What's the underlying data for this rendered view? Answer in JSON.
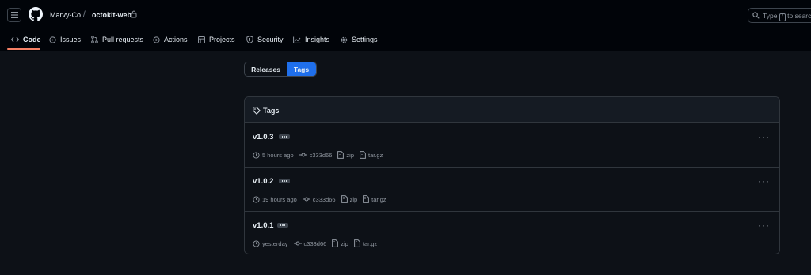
{
  "header": {
    "owner": "Marvy-Co",
    "separator": "/",
    "repo": "octokit-web",
    "search": {
      "placeholder_prefix": "Type",
      "shortcut": "/",
      "placeholder_suffix": "to search"
    }
  },
  "nav": {
    "tabs": [
      {
        "label": "Code",
        "icon": "code-icon",
        "active": true
      },
      {
        "label": "Issues",
        "icon": "issue-icon"
      },
      {
        "label": "Pull requests",
        "icon": "pull-request-icon"
      },
      {
        "label": "Actions",
        "icon": "play-icon"
      },
      {
        "label": "Projects",
        "icon": "table-icon"
      },
      {
        "label": "Security",
        "icon": "shield-icon"
      },
      {
        "label": "Insights",
        "icon": "graph-icon"
      },
      {
        "label": "Settings",
        "icon": "gear-icon"
      }
    ]
  },
  "toggle": {
    "releases": "Releases",
    "tags": "Tags",
    "selected": "Tags"
  },
  "tags_box": {
    "title": "Tags",
    "rows": [
      {
        "name": "v1.0.3",
        "time": "5 hours ago",
        "commit": "c333d66",
        "zip": "zip",
        "targz": "tar.gz"
      },
      {
        "name": "v1.0.2",
        "time": "19 hours ago",
        "commit": "c333d66",
        "zip": "zip",
        "targz": "tar.gz"
      },
      {
        "name": "v1.0.1",
        "time": "yesterday",
        "commit": "c333d66",
        "zip": "zip",
        "targz": "tar.gz"
      }
    ]
  },
  "colors": {
    "background": "#0d1117",
    "header_bg": "#010409",
    "accent_blue": "#1f6feb",
    "active_underline": "#f78166",
    "border": "#30363d"
  }
}
